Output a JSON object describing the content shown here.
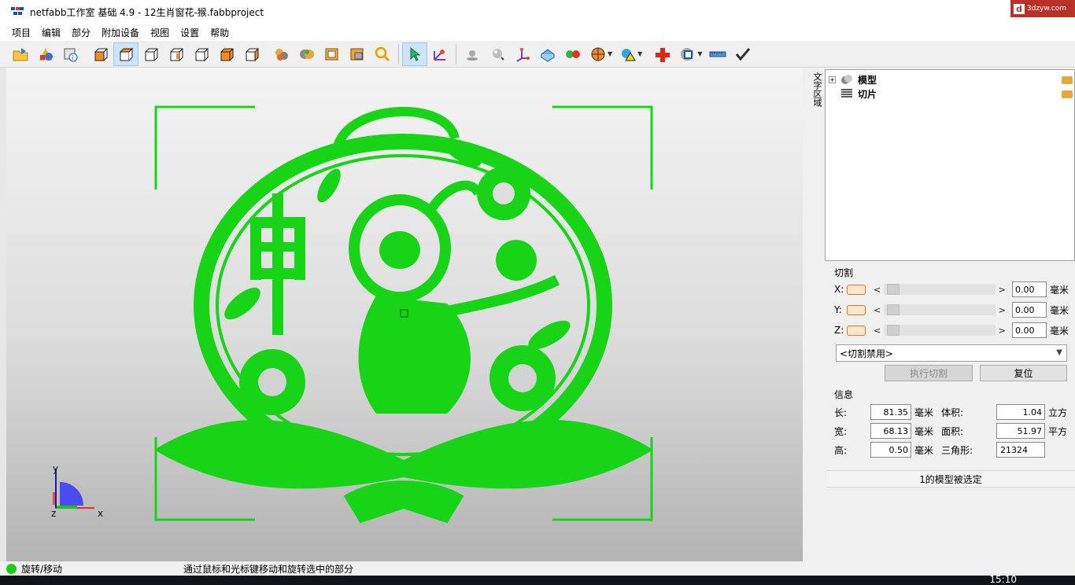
{
  "window": {
    "title": "netfabb工作室 基础 4.9 - 12生肖窗花-猴.fabbproject",
    "watermark_logo": "d",
    "watermark_text": "3dzyw.com"
  },
  "menu": [
    "项目",
    "编辑",
    "部分",
    "附加设备",
    "视图",
    "设置",
    "帮助"
  ],
  "toolbar": {
    "icons": [
      "open-project-icon",
      "add-part-icon",
      "part-info-icon",
      "view-front-icon",
      "view-top-icon",
      "view-back-icon",
      "view-left-icon",
      "view-right-icon",
      "view-bottom-icon",
      "view-iso-icon",
      "repair-icon",
      "shading-icon",
      "boundary-icon",
      "mesh-edit-icon",
      "zoom-icon",
      "select-icon",
      "rotate-move-icon",
      "point-icon",
      "sphere-icon",
      "axis-icon",
      "box-icon",
      "spheres-icon",
      "color-wheel-icon",
      "warning-icon",
      "add-red-icon",
      "settings-icon",
      "ruler-icon",
      "check-icon"
    ]
  },
  "viewport": {
    "axis_labels": {
      "x": "x",
      "y": "y",
      "z": "z"
    }
  },
  "panel": {
    "vertical_tab": "文字区域",
    "tree": [
      {
        "label": "模型",
        "icon": "model-icon"
      },
      {
        "label": "切片",
        "icon": "slice-icon"
      }
    ],
    "cut_section_label": "切割",
    "cut_rows": [
      {
        "axis": "X:",
        "value": "0.00",
        "unit": "毫米"
      },
      {
        "axis": "Y:",
        "value": "0.00",
        "unit": "毫米"
      },
      {
        "axis": "Z:",
        "value": "0.00",
        "unit": "毫米"
      }
    ],
    "slider_left": "<",
    "slider_right": ">",
    "cut_mode": "<切割禁用>",
    "execute_cut": "执行切割",
    "reset": "复位",
    "info_section_label": "信息",
    "info": {
      "length_label": "长:",
      "length": "81.35",
      "length_unit": "毫米",
      "width_label": "宽:",
      "width": "68.13",
      "width_unit": "毫米",
      "height_label": "高:",
      "height": "0.50",
      "height_unit": "毫米",
      "volume_label": "体积:",
      "volume": "1.04",
      "volume_unit": "立方",
      "area_label": "面积:",
      "area": "51.97",
      "area_unit": "平方",
      "triangles_label": "三角形:",
      "triangles": "21324"
    },
    "selection_status": "1的模型被选定"
  },
  "statusbar": {
    "mode": "旋转/移动",
    "hint": "通过鼠标和光标键移动和旋转选中的部分"
  },
  "taskbar": {
    "clock": "15:10"
  },
  "colors": {
    "model_green": "#17d417",
    "bracket_green": "#17d417"
  }
}
